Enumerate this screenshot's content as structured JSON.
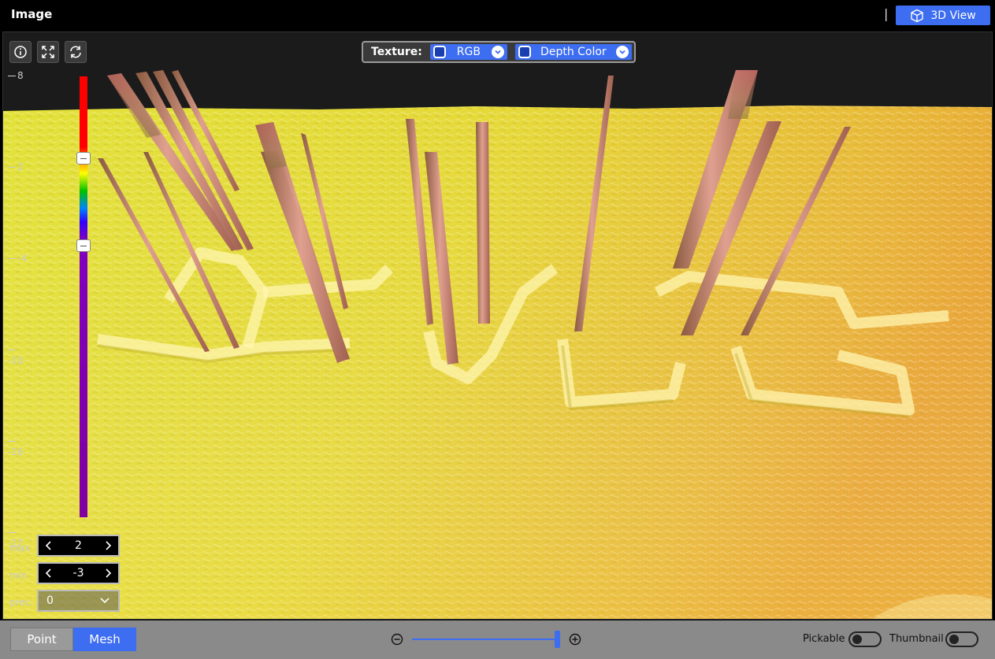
{
  "header": {
    "title": "Image",
    "separator": "|",
    "view_button_label": "3D View"
  },
  "toolbar": {
    "info_icon": "info-icon",
    "fullscreen_icon": "expand-icon",
    "reset_icon": "refresh-icon"
  },
  "texture": {
    "label": "Texture:",
    "primary": {
      "value": "RGB",
      "checked": false
    },
    "secondary": {
      "value": "Depth Color",
      "checked": false
    }
  },
  "scale": {
    "ticks": [
      "8",
      "2",
      "-4",
      "-10",
      "-16",
      "-22"
    ],
    "colors": [
      "#ff0000",
      "#ffff00",
      "#00c000",
      "#0080ff",
      "#8000a0"
    ]
  },
  "controls": {
    "max_label": "max",
    "max_value": "2",
    "min_label": "min",
    "min_value": "-3",
    "prec_label": "prec.",
    "prec_value": "0"
  },
  "footer": {
    "mode_point": "Point",
    "mode_mesh": "Mesh",
    "active_mode": "Mesh",
    "zoom_level": 1.0,
    "pickable_label": "Pickable",
    "pickable_on": false,
    "thumbnail_label": "Thumbnail",
    "thumbnail_on": false
  },
  "colors": {
    "accent": "#3d6df0",
    "surface_yellow": "#e8e040",
    "surface_orange": "#e8a030",
    "spike": "#c07070"
  }
}
